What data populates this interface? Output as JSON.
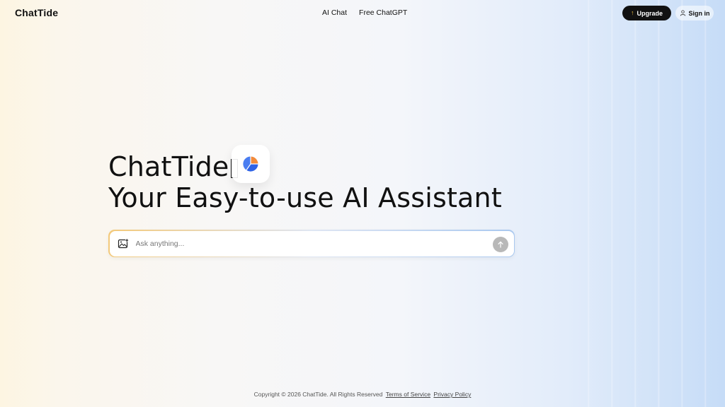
{
  "header": {
    "logo": "ChatTide",
    "nav": [
      {
        "label": "AI Chat"
      },
      {
        "label": "Free ChatGPT"
      }
    ],
    "upgrade_label": "Upgrade",
    "signin_label": "Sign in"
  },
  "hero": {
    "line1": "ChatTide",
    "line2": "Your Easy-to-use AI Assistant"
  },
  "ask": {
    "placeholder": "Ask anything..."
  },
  "footer": {
    "copyright": "Copyright © 2026 ChatTide. All Rights Reserved",
    "terms": "Terms of Service",
    "privacy": "Privacy Policy"
  },
  "icons": {
    "upgrade": "arrow-up-icon",
    "signin": "user-icon",
    "image": "image-upload-icon",
    "send": "arrow-up-icon",
    "badge": "pie-chart-icon"
  },
  "colors": {
    "accent": "#111111",
    "upgrade_arrow": "#f5c542",
    "badge_blue": "#2f63e6",
    "badge_orange": "#f28b3c"
  }
}
